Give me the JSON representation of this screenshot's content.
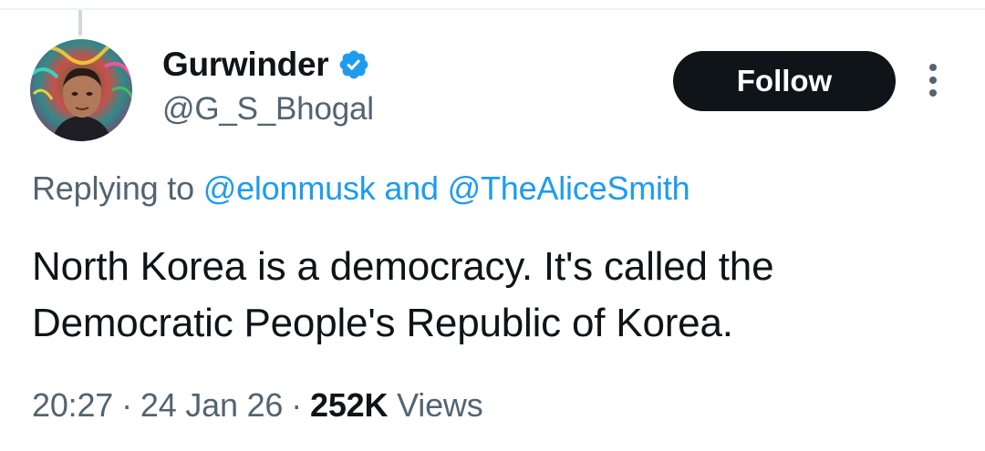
{
  "author": {
    "display_name": "Gurwinder",
    "handle": "@G_S_Bhogal",
    "verified": true,
    "avatar_icon": "profile-photo"
  },
  "actions": {
    "follow_label": "Follow",
    "more_icon": "more-vertical-icon"
  },
  "reply_context": {
    "prefix": "Replying to",
    "mentions": [
      "@elonmusk",
      "@TheAliceSmith"
    ],
    "joiner": "and"
  },
  "tweet": {
    "text": "North Korea is a democracy. It's called the Democratic People's Republic of Korea."
  },
  "meta": {
    "time": "20:27",
    "separator": "·",
    "date": "24 Jan 26",
    "views_count": "252K",
    "views_label": "Views"
  },
  "colors": {
    "text_primary": "#0f1419",
    "text_secondary": "#536471",
    "accent": "#1d9bf0",
    "follow_bg": "#0f1419",
    "verified": "#1d9bf0"
  }
}
